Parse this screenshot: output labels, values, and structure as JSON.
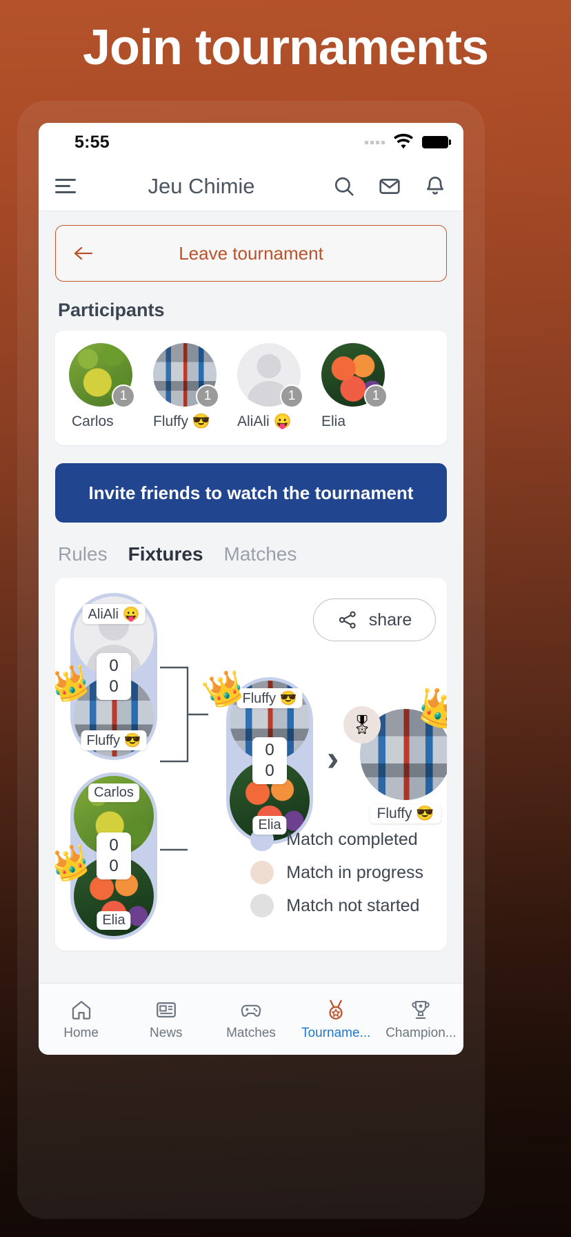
{
  "hero": {
    "title": "Join tournaments"
  },
  "status_bar": {
    "time": "5:55",
    "wifi": "wifi-icon",
    "battery": "battery-icon",
    "signal": "signal-dots"
  },
  "header": {
    "title": "Jeu Chimie",
    "menu_icon": "hamburger-icon",
    "search_icon": "search-icon",
    "mail_icon": "mail-icon",
    "bell_icon": "bell-icon"
  },
  "leave": {
    "label": "Leave tournament",
    "arrow_icon": "arrow-left-icon",
    "color": "#bb522a"
  },
  "participants": {
    "title": "Participants",
    "items": [
      {
        "name": "Carlos",
        "badge": "1",
        "avatar": "leaf-photo"
      },
      {
        "name": "Fluffy 😎",
        "badge": "1",
        "avatar": "collage-photo"
      },
      {
        "name": "AliAli 😛",
        "badge": "1",
        "avatar": "default-person"
      },
      {
        "name": "Elia",
        "badge": "1",
        "avatar": "flower-photo"
      }
    ]
  },
  "invite": {
    "label": "Invite friends to watch the tournament",
    "color": "#22458f"
  },
  "tabs": [
    {
      "label": "Rules",
      "active": false
    },
    {
      "label": "Fixtures",
      "active": true
    },
    {
      "label": "Matches",
      "active": false
    }
  ],
  "bracket": {
    "share": {
      "label": "share",
      "icon": "share-icon"
    },
    "semifinal_1": {
      "top_name": "AliAli 😛",
      "bottom_name": "Fluffy 😎",
      "score_top": "0",
      "score_bottom": "0",
      "winner_crown": "👑",
      "status": "completed"
    },
    "semifinal_2": {
      "top_name": "Carlos",
      "bottom_name": "Elia",
      "score_top": "0",
      "score_bottom": "0",
      "winner_crown": "👑",
      "status": "completed"
    },
    "final": {
      "top_name": "Fluffy 😎",
      "bottom_name": "Elia",
      "score_top": "0",
      "score_bottom": "0",
      "winner_crown": "👑",
      "status": "completed"
    },
    "champion": {
      "name": "Fluffy 😎",
      "crown": "👑",
      "medal_icon": "🎖",
      "chevron": "›"
    },
    "legend": [
      {
        "label": "Match completed",
        "color": "#c6d0ea"
      },
      {
        "label": "Match in progress",
        "color": "#eeddd0"
      },
      {
        "label": "Match not started",
        "color": "#e0e0e0"
      }
    ]
  },
  "bottom_nav": [
    {
      "label": "Home",
      "icon": "home-icon",
      "active": false
    },
    {
      "label": "News",
      "icon": "news-icon",
      "active": false
    },
    {
      "label": "Matches",
      "icon": "gamepad-icon",
      "active": false
    },
    {
      "label": "Tourname...",
      "icon": "medal-icon",
      "active": true
    },
    {
      "label": "Champion...",
      "icon": "trophy-icon",
      "active": false
    }
  ]
}
